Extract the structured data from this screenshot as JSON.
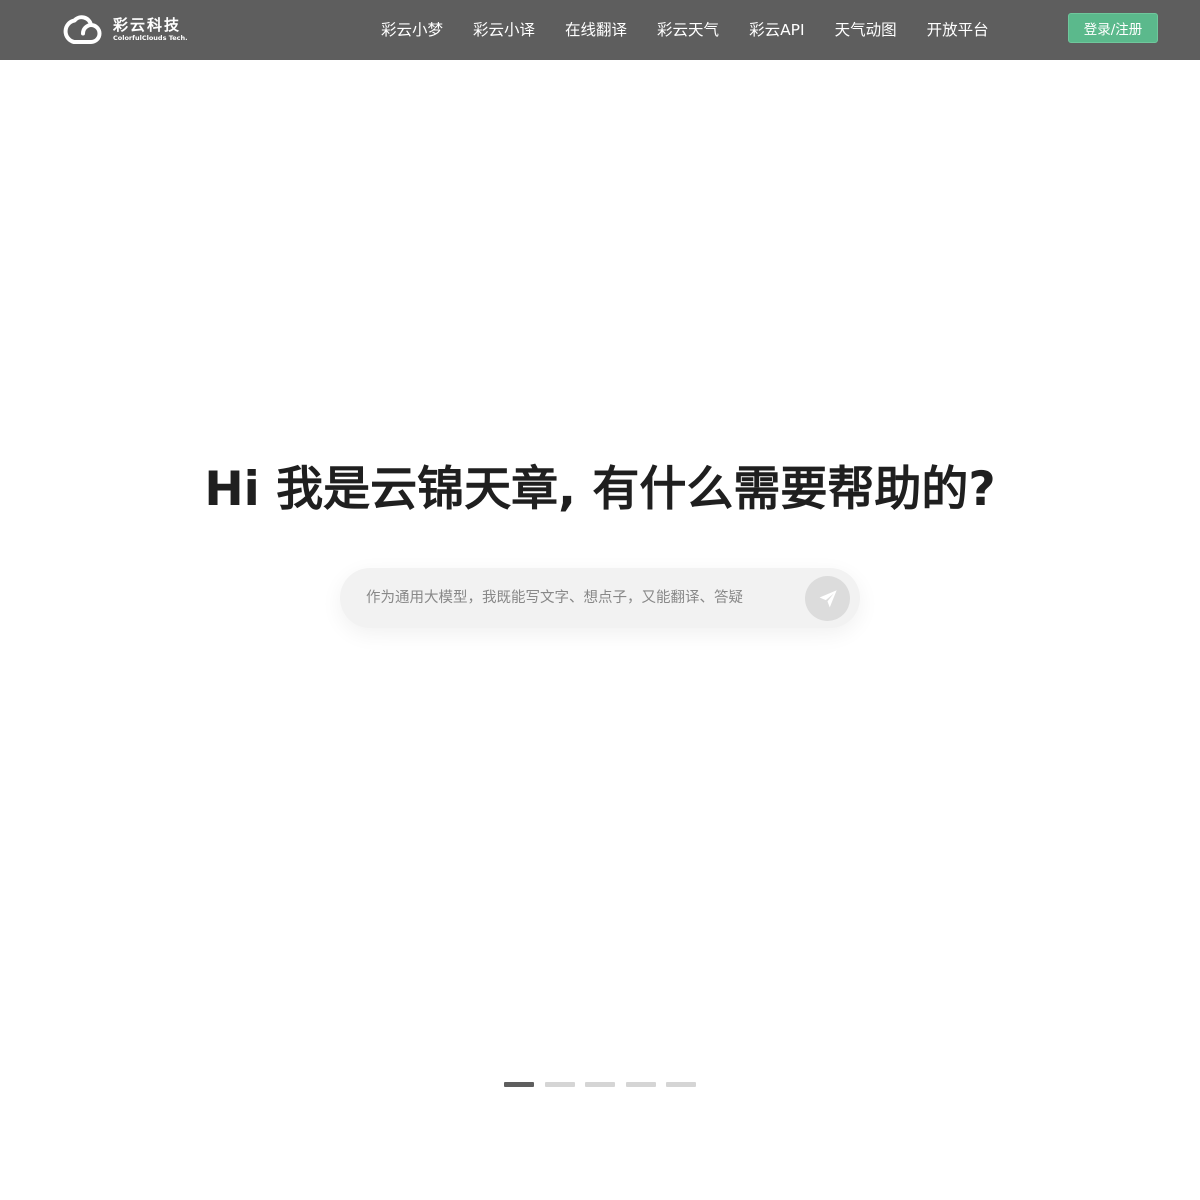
{
  "header": {
    "logo": {
      "name_cn": "彩云科技",
      "name_en": "ColorfulClouds Tech."
    },
    "nav_items": [
      {
        "label": "彩云小梦"
      },
      {
        "label": "彩云小译"
      },
      {
        "label": "在线翻译"
      },
      {
        "label": "彩云天气"
      },
      {
        "label": "彩云API"
      },
      {
        "label": "天气动图"
      },
      {
        "label": "开放平台"
      }
    ],
    "login_label": "登录/注册"
  },
  "hero": {
    "title": "Hi 我是云锦天章, 有什么需要帮助的?",
    "search": {
      "value": "",
      "placeholder": "作为通用大模型，我既能写文字、想点子，又能翻译、答疑",
      "send_icon": "paper-plane-icon"
    }
  },
  "carousel": {
    "count": 5,
    "active_index": 0
  },
  "colors": {
    "header_bg": "#5e5e5e",
    "accent": "#5bb98c",
    "title_text": "#1f1f1f",
    "search_bg": "#f2f2f2",
    "send_button_bg": "#dcdcdc",
    "indicator_active": "#5e5e5e",
    "indicator_inactive": "#d5d5d5"
  }
}
